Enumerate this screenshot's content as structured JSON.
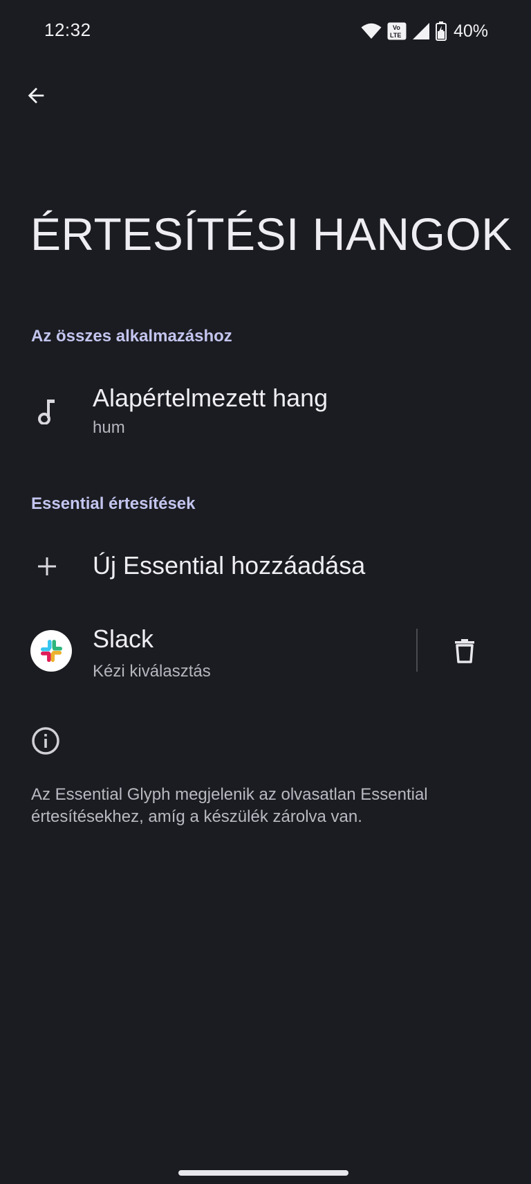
{
  "status_bar": {
    "time": "12:32",
    "volte_label_top": "Vo",
    "volte_label_bottom": "LTE",
    "battery": "40%",
    "icons": [
      "wifi-icon",
      "volte-icon",
      "cell-signal-icon",
      "battery-charging-icon"
    ]
  },
  "header": {
    "back_icon": "arrow-left-icon",
    "title": "ÉRTESÍTÉSI HANGOK"
  },
  "sections": {
    "all_apps": {
      "header": "Az összes alkalmazáshoz",
      "default_sound": {
        "icon": "music-note-icon",
        "title": "Alapértelmezett hang",
        "subtitle": "hum"
      }
    },
    "essential": {
      "header": "Essential értesítések",
      "add_item": {
        "icon": "plus-icon",
        "title": "Új Essential hozzáadása"
      },
      "apps": [
        {
          "icon": "slack-logo-icon",
          "title": "Slack",
          "subtitle": "Kézi kiválasztás",
          "action_icon": "trash-icon"
        }
      ]
    }
  },
  "info": {
    "icon": "info-icon",
    "text": "Az Essential Glyph megjelenik az olvasatlan Essential értesítésekhez, amíg a készülék zárolva van."
  },
  "colors": {
    "background": "#1b1c21",
    "section_header": "#c3c5ef",
    "primary_text": "#eeeef2",
    "secondary_text": "#b6b6bf"
  }
}
